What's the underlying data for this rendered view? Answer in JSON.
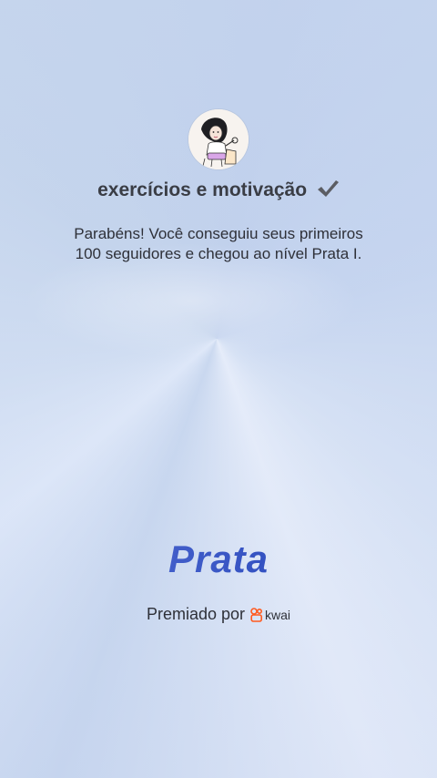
{
  "profile": {
    "avatar_icon": "cartoon-woman-avatar-icon",
    "name": "exercícios e motivação",
    "name_check_icon": "checkmark-icon"
  },
  "message": {
    "line1": "Parabéns! Você conseguiu seus primeiros",
    "line2": "100 seguidores e chegou ao nível Prata I."
  },
  "level": {
    "label": "Prata",
    "color": "#3f5ec8"
  },
  "awarded": {
    "prefix": "Premiado por",
    "brand_name": "kwai",
    "brand_icon": "kwai-logo-icon",
    "brand_color": "#ff5a1f"
  }
}
